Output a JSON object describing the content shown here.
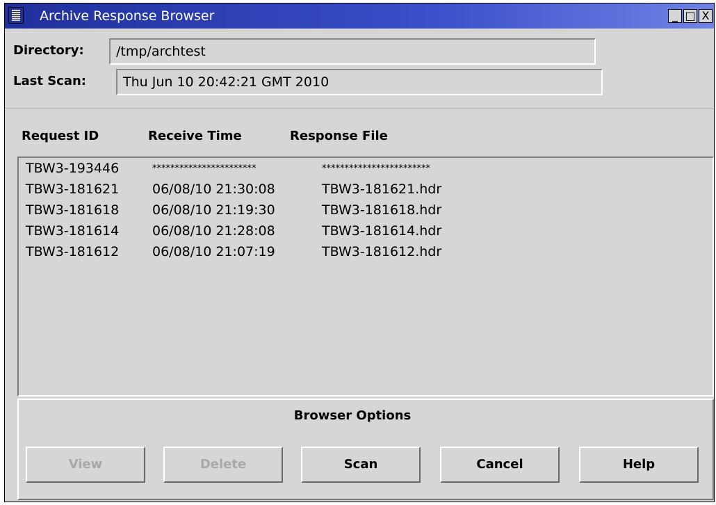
{
  "window": {
    "title": "Archive Response Browser",
    "minimize": "_",
    "maximize": "□",
    "close": "X"
  },
  "directory": {
    "label": "Directory:",
    "value": "/tmp/archtest"
  },
  "last_scan": {
    "label": "Last Scan:",
    "value": "Thu Jun 10 20:42:21 GMT 2010"
  },
  "list": {
    "columns": [
      "Request ID",
      "Receive Time",
      "Response File"
    ],
    "rows": [
      {
        "request_id": "TBW3-193446",
        "receive_time": "***********************",
        "response_file": "************************"
      },
      {
        "request_id": "TBW3-181621",
        "receive_time": "06/08/10 21:30:08",
        "response_file": "TBW3-181621.hdr"
      },
      {
        "request_id": "TBW3-181618",
        "receive_time": "06/08/10 21:19:30",
        "response_file": "TBW3-181618.hdr"
      },
      {
        "request_id": "TBW3-181614",
        "receive_time": "06/08/10 21:28:08",
        "response_file": "TBW3-181614.hdr"
      },
      {
        "request_id": "TBW3-181612",
        "receive_time": "06/08/10 21:07:19",
        "response_file": "TBW3-181612.hdr"
      }
    ]
  },
  "options": {
    "title": "Browser Options",
    "buttons": {
      "view": "View",
      "delete": "Delete",
      "scan": "Scan",
      "cancel": "Cancel",
      "help": "Help"
    }
  },
  "colors": {
    "titlebar": "#1f2f9c",
    "window_bg": "#d6d6d6",
    "disabled_text": "#a8a8a8"
  }
}
